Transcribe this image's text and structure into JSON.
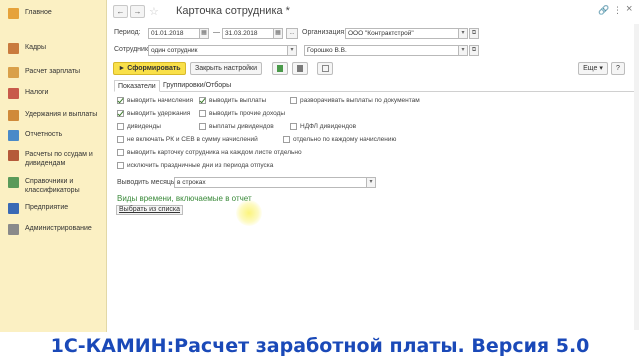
{
  "sidebar": {
    "items": [
      {
        "label": "Главное",
        "icon": "home-icon",
        "color": "#e6a23a"
      },
      {
        "label": "Кадры",
        "icon": "personnel-icon",
        "color": "#c97b3e"
      },
      {
        "label": "Расчет зарплаты",
        "icon": "payroll-icon",
        "color": "#d9a04a"
      },
      {
        "label": "Налоги",
        "icon": "taxes-icon",
        "color": "#c85a4a"
      },
      {
        "label": "Удержания и выплаты",
        "icon": "payments-icon",
        "color": "#d08a3a"
      },
      {
        "label": "Отчетность",
        "icon": "reports-icon",
        "color": "#4a8ac8"
      },
      {
        "label": "Расчеты по ссудам и дивидендам",
        "icon": "loans-icon",
        "color": "#b55a3a"
      },
      {
        "label": "Справочники и классификаторы",
        "icon": "directories-icon",
        "color": "#5a9a5a"
      },
      {
        "label": "Предприятие",
        "icon": "enterprise-icon",
        "color": "#3a6ab5"
      },
      {
        "label": "Администрирование",
        "icon": "admin-icon",
        "color": "#8a8a8a"
      }
    ]
  },
  "window": {
    "title": "Карточка сотрудника *",
    "back": "←",
    "forward": "→",
    "star": "☆",
    "link_icon": "🔗",
    "more_icon": "⋮",
    "close_icon": "×"
  },
  "period": {
    "label": "Период:",
    "from": "01.01.2018",
    "to": "31.03.2018",
    "dash": "—",
    "dots": "..."
  },
  "organization": {
    "label": "Организация:",
    "value": "ООО \"Контрактстрой\""
  },
  "employees": {
    "label": "Сотрудник:",
    "mode": "один сотрудник",
    "value": "Горошко В.В."
  },
  "toolbar": {
    "generate": "► Сформировать",
    "reset": "Закрыть настройки",
    "more": "Еще ▾",
    "help": "?"
  },
  "tabs": [
    {
      "label": "Показатели"
    },
    {
      "label": "Группировки/Отборы"
    }
  ],
  "checkboxes": {
    "accruals": {
      "label": "выводить начисления",
      "checked": true
    },
    "payments": {
      "label": "выводить выплаты",
      "checked": true
    },
    "payments_by_docs": {
      "label": "разворачивать выплаты по документам",
      "checked": false
    },
    "deductions": {
      "label": "выводить удержания",
      "checked": true
    },
    "other_income": {
      "label": "выводить прочие доходы",
      "checked": false
    },
    "dividends": {
      "label": "дивиденды",
      "checked": false
    },
    "dividend_payments": {
      "label": "выплаты дивидендов",
      "checked": false
    },
    "ndfl_dividends": {
      "label": "НДФЛ дивидендов",
      "checked": false
    },
    "no_rk_sev": {
      "label": "не включать РК и СЕВ в сумму начислений",
      "checked": false
    },
    "each_accrual": {
      "label": "отдельно по каждому начислению",
      "checked": false
    },
    "each_sheet": {
      "label": "выводить карточку сотрудника на каждом листе отдельно",
      "checked": false
    },
    "exclude_holidays": {
      "label": "исключить праздничные дни из периода отпуска",
      "checked": false
    }
  },
  "months": {
    "label": "Выводить месяцы:",
    "value": "в строках"
  },
  "time_types": {
    "label": "Виды времени, включаемые в отчет",
    "select_button": "Выбрать из списка"
  },
  "footer": {
    "text": "1С-КАМИН:Расчет заработной платы. Версия 5.0"
  },
  "colors": {
    "sidebar_bg": "#fbf0c3",
    "primary_button": "#f9e049",
    "green_text": "#3a8a3a",
    "footer_text": "#1a49b8"
  }
}
